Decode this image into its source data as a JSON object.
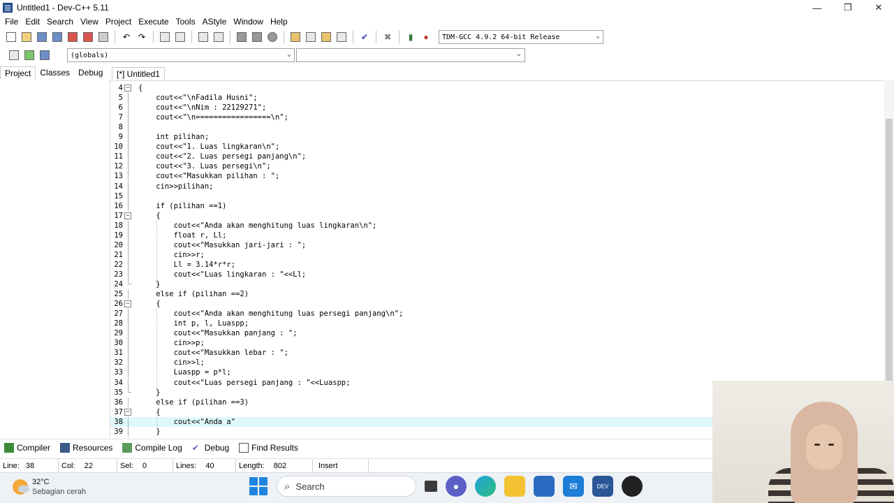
{
  "window": {
    "title": "Untitled1 - Dev-C++ 5.11",
    "controls": [
      "—",
      "❐",
      "✕"
    ]
  },
  "menu": [
    "File",
    "Edit",
    "Search",
    "View",
    "Project",
    "Execute",
    "Tools",
    "AStyle",
    "Window",
    "Help"
  ],
  "compiler": "TDM-GCC 4.9.2 64-bit Release",
  "globals": "(globals)",
  "side_tabs": [
    "Project",
    "Classes",
    "Debug"
  ],
  "editor_tab": "[*] Untitled1",
  "code_lines": [
    {
      "n": "4",
      "text": "{"
    },
    {
      "n": "5",
      "text": "    cout<<\"\\nFadila Husni\";"
    },
    {
      "n": "6",
      "text": "    cout<<\"\\nNim : 22129271\";"
    },
    {
      "n": "7",
      "text": "    cout<<\"\\n=================\\n\";"
    },
    {
      "n": "8",
      "text": ""
    },
    {
      "n": "9",
      "text": "    int pilihan;"
    },
    {
      "n": "10",
      "text": "    cout<<\"1. Luas lingkaran\\n\";"
    },
    {
      "n": "11",
      "text": "    cout<<\"2. Luas persegi panjang\\n\";"
    },
    {
      "n": "12",
      "text": "    cout<<\"3. Luas persegi\\n\";"
    },
    {
      "n": "13",
      "text": "    cout<<\"Masukkan pilihan : \";"
    },
    {
      "n": "14",
      "text": "    cin>>pilihan;"
    },
    {
      "n": "15",
      "text": ""
    },
    {
      "n": "16",
      "text": "    if (pilihan ==1)"
    },
    {
      "n": "17",
      "text": "    {"
    },
    {
      "n": "18",
      "text": "        cout<<\"Anda akan menghitung luas lingkaran\\n\";"
    },
    {
      "n": "19",
      "text": "        float r, Ll;"
    },
    {
      "n": "20",
      "text": "        cout<<\"Masukkan jari-jari : \";"
    },
    {
      "n": "21",
      "text": "        cin>>r;"
    },
    {
      "n": "22",
      "text": "        Ll = 3.14*r*r;"
    },
    {
      "n": "23",
      "text": "        cout<<\"Luas lingkaran : \"<<Ll;"
    },
    {
      "n": "24",
      "text": "    }"
    },
    {
      "n": "25",
      "text": "    else if (pilihan ==2)"
    },
    {
      "n": "26",
      "text": "    {"
    },
    {
      "n": "27",
      "text": "        cout<<\"Anda akan menghitung luas persegi panjang\\n\";"
    },
    {
      "n": "28",
      "text": "        int p, l, Luaspp;"
    },
    {
      "n": "29",
      "text": "        cout<<\"Masukkan panjang : \";"
    },
    {
      "n": "30",
      "text": "        cin>>p;"
    },
    {
      "n": "31",
      "text": "        cout<<\"Masukkan lebar : \";"
    },
    {
      "n": "32",
      "text": "        cin>>l;"
    },
    {
      "n": "33",
      "text": "        Luaspp = p*l;"
    },
    {
      "n": "34",
      "text": "        cout<<\"Luas persegi panjang : \"<<Luaspp;"
    },
    {
      "n": "35",
      "text": "    }"
    },
    {
      "n": "36",
      "text": "    else if (pilihan ==3)"
    },
    {
      "n": "37",
      "text": "    {"
    },
    {
      "n": "38",
      "text": "        cout<<\"Anda a\""
    },
    {
      "n": "39",
      "text": "    }"
    }
  ],
  "bottom_tabs": [
    "Compiler",
    "Resources",
    "Compile Log",
    "Debug",
    "Find Results"
  ],
  "status": {
    "line_label": "Line:",
    "line_value": "38",
    "col_label": "Col:",
    "col_value": "22",
    "sel_label": "Sel:",
    "sel_value": "0",
    "lines_label": "Lines:",
    "lines_value": "40",
    "length_label": "Length:",
    "length_value": "802",
    "mode": "Insert"
  },
  "taskbar": {
    "temperature": "32°C",
    "weather": "Sebagian cerah",
    "search_placeholder": "Search"
  }
}
